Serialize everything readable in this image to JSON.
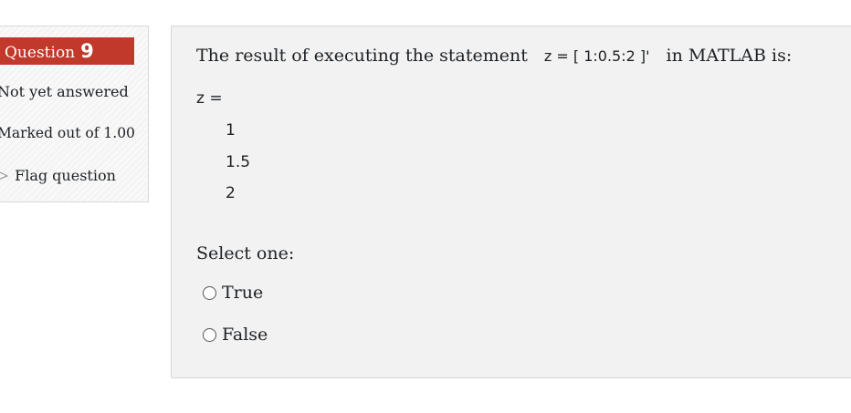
{
  "info": {
    "question_label": "Question",
    "question_number": "9",
    "state": "Not yet answered",
    "grade": "Marked out of 1.00",
    "flag_label": "Flag question"
  },
  "question": {
    "text_before": "The result of executing the statement",
    "code": "z = [ 1:0.5:2 ]'",
    "text_after": "in MATLAB is:",
    "output_var": "z =",
    "output_values": [
      "1",
      "1.5",
      "2"
    ]
  },
  "answer": {
    "prompt": "Select one:",
    "options": [
      "True",
      "False"
    ]
  },
  "colors": {
    "question_badge": "#c0392b",
    "info_bg": "#f4f4f4",
    "content_bg": "#f2f2f2"
  }
}
